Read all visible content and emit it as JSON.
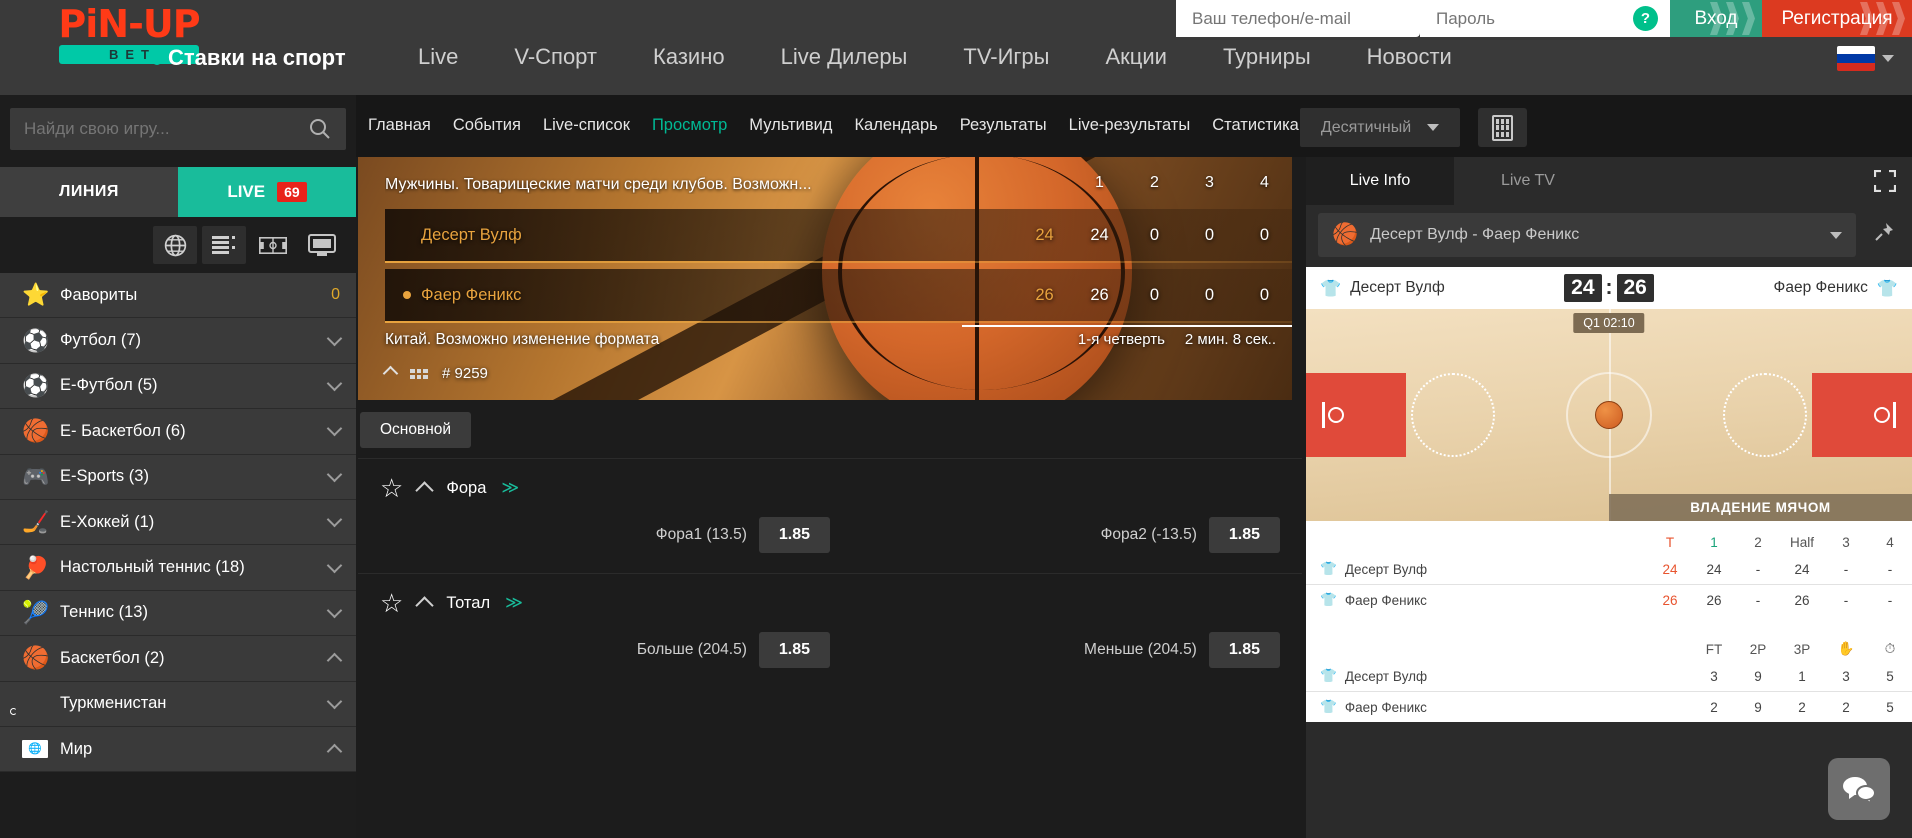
{
  "brand": {
    "name": "PiN-UP",
    "sub": "BET"
  },
  "header": {
    "sports_label": "Ставки на спорт",
    "nav": [
      {
        "label": "Live"
      },
      {
        "label": "V-Спорт"
      },
      {
        "label": "Казино"
      },
      {
        "label": "Live Дилеры"
      },
      {
        "label": "TV-Игры"
      },
      {
        "label": "Акции"
      },
      {
        "label": "Турниры"
      },
      {
        "label": "Новости"
      }
    ],
    "login": {
      "phone_placeholder": "Ваш телефон/e-mail",
      "password_placeholder": "Пароль",
      "help_badge": "?",
      "login_button": "Вход",
      "register_button": "Регистрация"
    },
    "language": "ru"
  },
  "subnav": {
    "links": [
      {
        "label": "Главная",
        "active": false
      },
      {
        "label": "События",
        "active": false
      },
      {
        "label": "Live-список",
        "active": false
      },
      {
        "label": "Просмотр",
        "active": true
      },
      {
        "label": "Мультивид",
        "active": false
      },
      {
        "label": "Календарь",
        "active": false
      },
      {
        "label": "Результаты",
        "active": false
      },
      {
        "label": "Live-результаты",
        "active": false
      },
      {
        "label": "Статистика",
        "active": false
      }
    ],
    "odds_format": "Десятичный"
  },
  "sidebar": {
    "search_placeholder": "Найди свою игру...",
    "tab_line": "ЛИНИЯ",
    "tab_live": "LIVE",
    "live_count": "69",
    "sports": [
      {
        "icon": "⭐",
        "label": "Фавориты",
        "count": "0",
        "chevron": "none"
      },
      {
        "icon": "⚽",
        "label": "Футбол (7)",
        "chevron": "down"
      },
      {
        "icon": "⚽",
        "label": "Е-Футбол (5)",
        "chevron": "down"
      },
      {
        "icon": "🏀",
        "label": "Е- Баскетбол (6)",
        "chevron": "down"
      },
      {
        "icon": "🎮",
        "label": "E-Sports (3)",
        "chevron": "down"
      },
      {
        "icon": "🏒",
        "label": "Е-Хоккей (1)",
        "chevron": "down"
      },
      {
        "icon": "🏓",
        "label": "Настольный теннис (18)",
        "chevron": "down"
      },
      {
        "icon": "🎾",
        "label": "Теннис (13)",
        "chevron": "down"
      },
      {
        "icon": "🏀",
        "label": "Баскетбол (2)",
        "chevron": "up"
      },
      {
        "icon": "flag-tm",
        "label": "Туркменистан",
        "chevron": "down"
      },
      {
        "icon": "flag-world",
        "label": "Мир",
        "chevron": "up"
      }
    ]
  },
  "scoreboard": {
    "title": "Мужчины. Товарищеские матчи среди клубов. Возможн...",
    "columns": [
      "",
      "1",
      "2",
      "3",
      "4"
    ],
    "rows": [
      {
        "team": "Десерт Вулф",
        "dot": false,
        "scores": [
          "24",
          "24",
          "0",
          "0",
          "0"
        ]
      },
      {
        "team": "Фаер Феникс",
        "dot": true,
        "scores": [
          "26",
          "26",
          "0",
          "0",
          "0"
        ]
      }
    ],
    "subtitle": "Китай. Возможно изменение формата",
    "period": "1-я четверть",
    "clock": "2 мин. 8 сек..",
    "match_id": "# 9259"
  },
  "markets": {
    "tab": "Основной",
    "items": [
      {
        "title": "Фора",
        "odds": [
          {
            "label": "Фора1 (13.5)",
            "value": "1.85"
          },
          {
            "label": "Фора2 (-13.5)",
            "value": "1.85"
          }
        ]
      },
      {
        "title": "Тотал",
        "odds": [
          {
            "label": "Больше (204.5)",
            "value": "1.85"
          },
          {
            "label": "Меньше (204.5)",
            "value": "1.85"
          }
        ]
      }
    ]
  },
  "right_panel": {
    "tabs": [
      {
        "label": "Live Info",
        "active": true
      },
      {
        "label": "Live TV",
        "active": false
      }
    ],
    "match_select": "Десерт Вулф - Фаер Феникс",
    "home_team": "Десерт Вулф",
    "away_team": "Фаер Феникс",
    "home_score": "24",
    "away_score": "26",
    "score_colon": ":",
    "quarter_chip": "Q1 02:10",
    "possession_label": "ВЛАДЕНИЕ МЯЧОМ",
    "period_table": {
      "headers": [
        "",
        "T",
        "1",
        "2",
        "Half",
        "3",
        "4"
      ],
      "rows": [
        {
          "team": "Десерт Вулф",
          "total": "24",
          "cells": [
            "24",
            "-",
            "24",
            "-",
            "-"
          ]
        },
        {
          "team": "Фаер Феникс",
          "total": "26",
          "cells": [
            "26",
            "-",
            "26",
            "-",
            "-"
          ]
        }
      ]
    },
    "stats_table": {
      "headers": [
        "",
        "FT",
        "2P",
        "3P",
        "✋",
        "⏱"
      ],
      "rows": [
        {
          "team": "Десерт Вулф",
          "cells": [
            "3",
            "9",
            "1",
            "3",
            "5"
          ]
        },
        {
          "team": "Фаер Феникс",
          "cells": [
            "2",
            "9",
            "2",
            "2",
            "5"
          ]
        }
      ]
    }
  },
  "colors": {
    "accent_teal": "#19bc9b",
    "accent_red": "#dc3a20",
    "logo_red": "#ff3a17",
    "gold": "#e8a33e"
  }
}
